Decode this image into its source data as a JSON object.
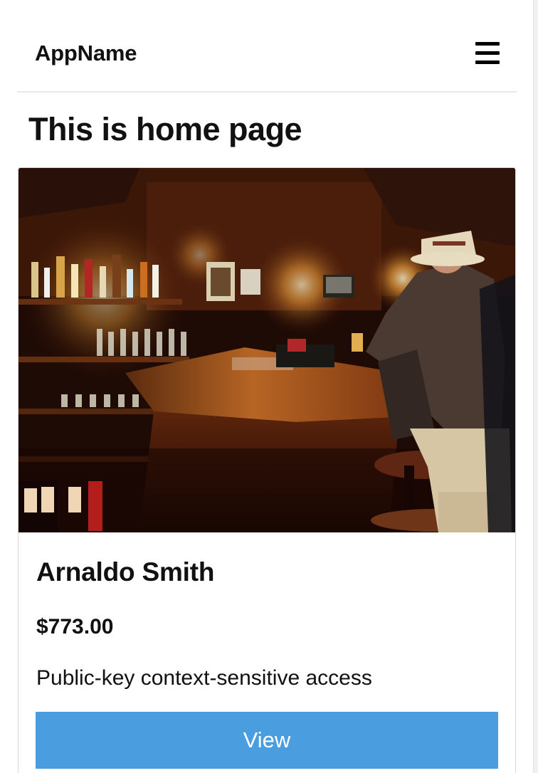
{
  "navbar": {
    "brand": "AppName",
    "menu_icon": "hamburger-menu-icon"
  },
  "main": {
    "title": "This is home page"
  },
  "product_card": {
    "image_description": "Dimly lit bar interior with a man in a hat and suit seated on a bar stool",
    "name": "Arnaldo Smith",
    "price": "$773.00",
    "description": "Public-key context-sensitive access",
    "button_label": "View"
  },
  "colors": {
    "button_background": "#4a9ddf",
    "button_text": "#ffffff",
    "navbar_divider": "#e6e7f3",
    "card_border": "#d8d8d8",
    "text": "#111111"
  }
}
